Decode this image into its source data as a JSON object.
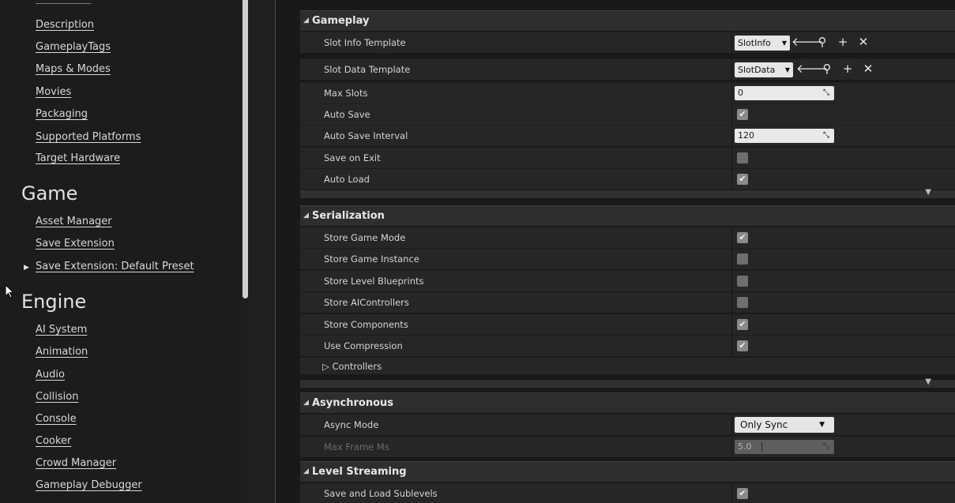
{
  "sidebar": {
    "project_links": [
      "Description",
      "GameplayTags",
      "Maps & Modes",
      "Movies",
      "Packaging",
      "Supported Platforms",
      "Target Hardware"
    ],
    "game_header": "Game",
    "game_links": [
      "Asset Manager",
      "Save Extension",
      "Save Extension: Default Preset"
    ],
    "engine_header": "Engine",
    "engine_links": [
      "AI System",
      "Animation",
      "Audio",
      "Collision",
      "Console",
      "Cooker",
      "Crowd Manager",
      "Gameplay Debugger"
    ]
  },
  "details": {
    "gameplay": {
      "title": "Gameplay",
      "slot_info_template": {
        "label": "Slot Info Template",
        "value": "SlotInfo"
      },
      "slot_data_template": {
        "label": "Slot Data Template",
        "value": "SlotData"
      },
      "max_slots": {
        "label": "Max Slots",
        "value": "0"
      },
      "auto_save": {
        "label": "Auto Save",
        "checked": true
      },
      "auto_save_interval": {
        "label": "Auto Save Interval",
        "value": "120"
      },
      "save_on_exit": {
        "label": "Save on Exit",
        "checked": false
      },
      "auto_load": {
        "label": "Auto Load",
        "checked": true
      }
    },
    "serialization": {
      "title": "Serialization",
      "store_game_mode": {
        "label": "Store Game Mode",
        "checked": true
      },
      "store_game_instance": {
        "label": "Store Game Instance",
        "checked": false
      },
      "store_level_blueprints": {
        "label": "Store Level Blueprints",
        "checked": false
      },
      "store_ai_controllers": {
        "label": "Store AIControllers",
        "checked": false
      },
      "store_components": {
        "label": "Store Components",
        "checked": true
      },
      "use_compression": {
        "label": "Use Compression",
        "checked": true
      },
      "controllers": {
        "label": "Controllers"
      }
    },
    "asynchronous": {
      "title": "Asynchronous",
      "async_mode": {
        "label": "Async Mode",
        "value": "Only Sync"
      },
      "max_frame_ms": {
        "label": "Max Frame Ms",
        "value": "5.0"
      }
    },
    "level_streaming": {
      "title": "Level Streaming",
      "save_and_load_sublevels": {
        "label": "Save and Load Sublevels",
        "checked": true
      }
    }
  },
  "icons": {
    "checkmark": "✔",
    "dropdown_caret": "▼",
    "section_open": "◢",
    "section_closed": "▷",
    "tree_collapsed": "▶",
    "use_selected": "🡐",
    "browse": "⚲",
    "add": "+",
    "clear": "✕",
    "spinner": "⤡",
    "footer_expand": "▼"
  },
  "colors": {
    "panel_bg": "#191919",
    "row_bg": "#262626",
    "category_bg": "#2e2e2e",
    "input_bg": "#e9e9e9",
    "checkbox_bg": "#6f6f6f",
    "text": "#d4d4d4"
  }
}
